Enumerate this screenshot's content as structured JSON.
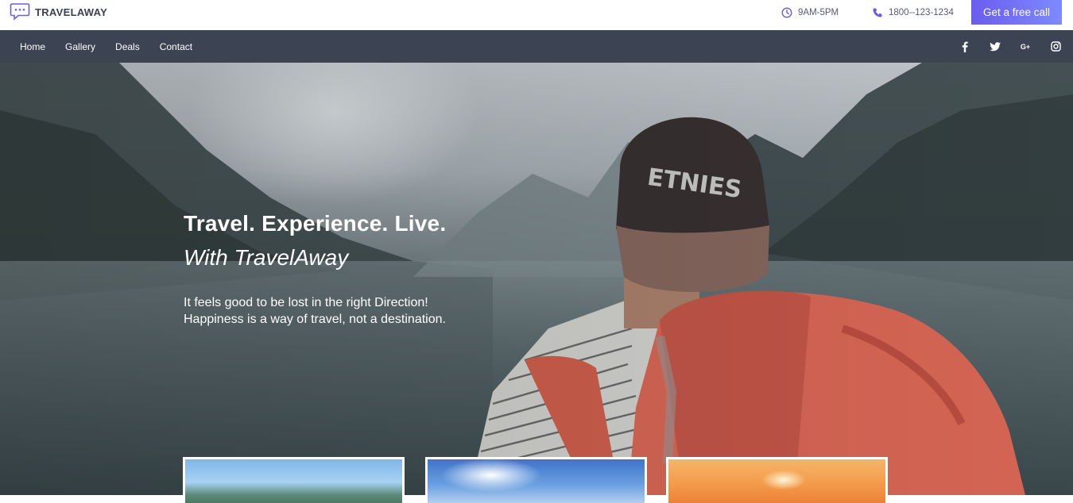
{
  "header": {
    "brand": "TRAVELAWAY",
    "hours": "9AM-5PM",
    "phone": "1800--123-1234",
    "cta_label": "Get a free call"
  },
  "nav": {
    "items": [
      {
        "label": "Home"
      },
      {
        "label": "Gallery"
      },
      {
        "label": "Deals"
      },
      {
        "label": "Contact"
      }
    ],
    "social": [
      "facebook-icon",
      "twitter-icon",
      "google-plus-icon",
      "instagram-icon"
    ],
    "google_plus_glyph": "G+"
  },
  "hero": {
    "title": "Travel. Experience. Live.",
    "subtitle": "With TravelAway",
    "desc_line1": "It feels good to be lost in the right Direction!",
    "desc_line2": "Happiness is a way of travel, not a destination."
  },
  "colors": {
    "accent": "#6b5cf0",
    "nav_bg": "#3c4353",
    "brand_text": "#3a3f52"
  }
}
